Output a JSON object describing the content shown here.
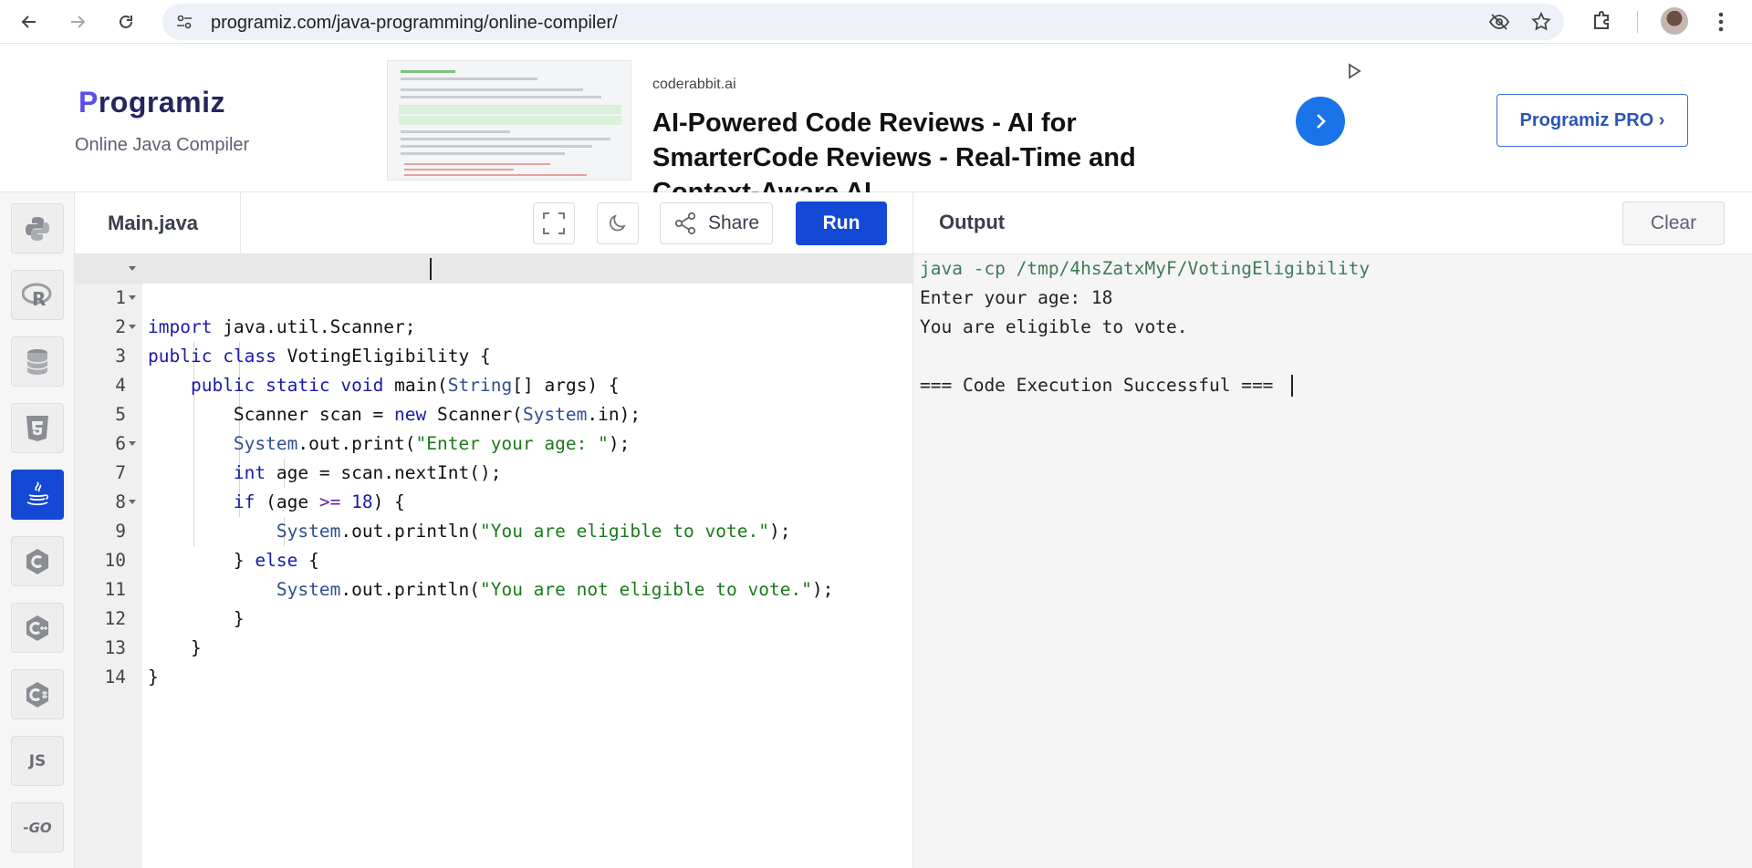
{
  "browser": {
    "url": "programiz.com/java-programming/online-compiler/"
  },
  "header": {
    "logo_first": "P",
    "logo_rest": "rogramiz",
    "subtitle": "Online Java Compiler",
    "pro_button": "Programiz PRO ›"
  },
  "ad": {
    "domain": "coderabbit.ai",
    "title": "AI-Powered Code Reviews - AI for SmarterCode Reviews - Real-Time and Context-Aware AI"
  },
  "languages": [
    {
      "name": "python-icon"
    },
    {
      "name": "r-icon"
    },
    {
      "name": "sql-icon"
    },
    {
      "name": "html5-icon"
    },
    {
      "name": "java-icon",
      "active": true
    },
    {
      "name": "c-icon"
    },
    {
      "name": "cpp-icon"
    },
    {
      "name": "csharp-icon"
    },
    {
      "name": "js-icon",
      "label": "JS"
    },
    {
      "name": "go-icon",
      "label": "-GO"
    }
  ],
  "editor": {
    "filename": "Main.java",
    "share_label": "Share",
    "run_label": "Run",
    "line_numbers": [
      "1",
      "2",
      "3",
      "4",
      "5",
      "6",
      "7",
      "8",
      "9",
      "10",
      "11",
      "12",
      "13",
      "14"
    ]
  },
  "output": {
    "title": "Output",
    "clear_label": "Clear",
    "lines": [
      "java -cp /tmp/4hsZatxMyF/VotingEligibility",
      "Enter your age: 18",
      "You are eligible to vote.",
      "",
      "=== Code Execution Successful ==="
    ]
  },
  "colors": {
    "brand": "#1449d6",
    "logo_accent": "#5c4eea"
  }
}
